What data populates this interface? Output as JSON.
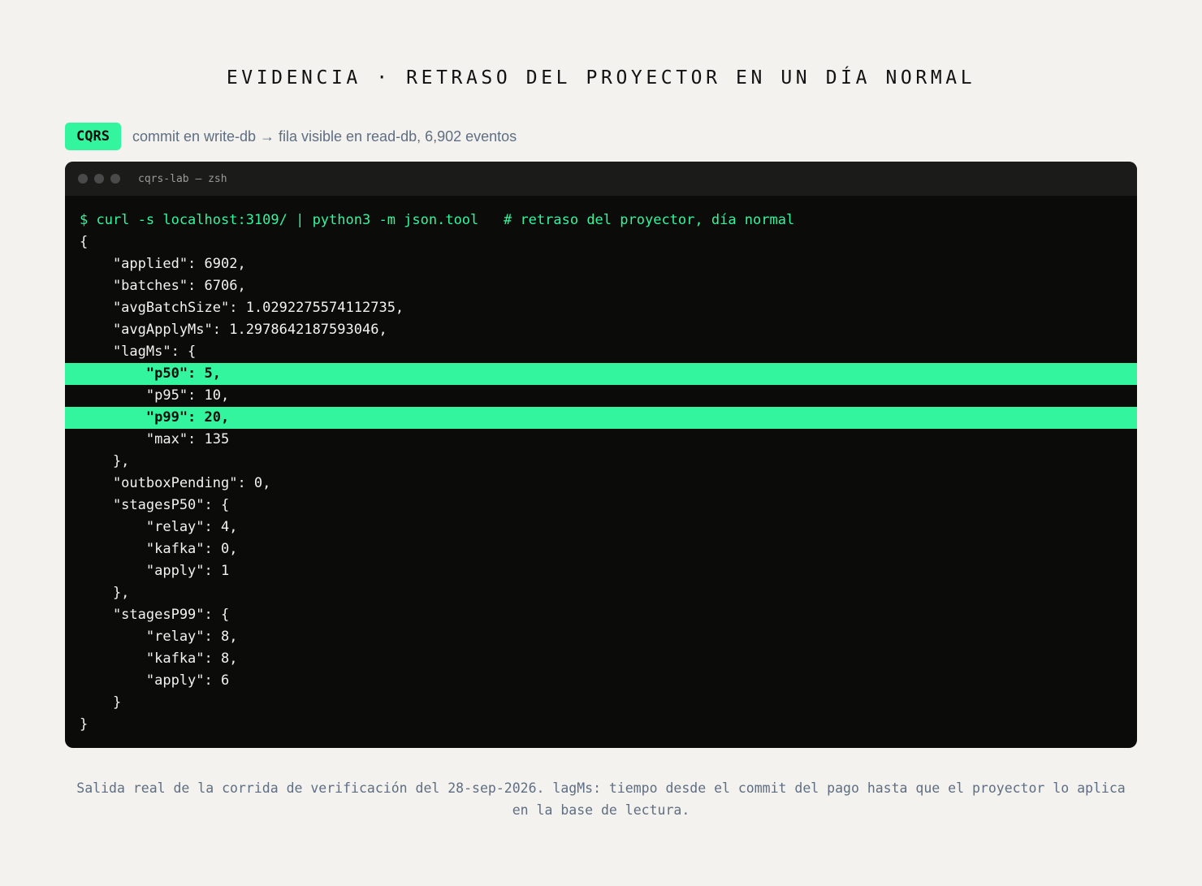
{
  "title": "EVIDENCIA · RETRASO DEL PROYECTOR EN UN DÍA NORMAL",
  "tag": {
    "label": "CQRS",
    "caption": "commit en write-db → fila visible en read-db, 6,902 eventos"
  },
  "terminal": {
    "window_title": "cqrs-lab — zsh",
    "lines": [
      {
        "text": "$ curl -s localhost:3109/ | python3 -m json.tool   # retraso del proyector, día normal",
        "kind": "cmd"
      },
      {
        "text": "{",
        "kind": "out"
      },
      {
        "text": "    \"applied\": 6902,",
        "kind": "out"
      },
      {
        "text": "    \"batches\": 6706,",
        "kind": "out"
      },
      {
        "text": "    \"avgBatchSize\": 1.0292275574112735,",
        "kind": "out"
      },
      {
        "text": "    \"avgApplyMs\": 1.2978642187593046,",
        "kind": "out"
      },
      {
        "text": "    \"lagMs\": {",
        "kind": "out"
      },
      {
        "text": "        \"p50\": 5,",
        "kind": "hl"
      },
      {
        "text": "        \"p95\": 10,",
        "kind": "out"
      },
      {
        "text": "        \"p99\": 20,",
        "kind": "hl"
      },
      {
        "text": "        \"max\": 135",
        "kind": "out"
      },
      {
        "text": "    },",
        "kind": "out"
      },
      {
        "text": "    \"outboxPending\": 0,",
        "kind": "out"
      },
      {
        "text": "    \"stagesP50\": {",
        "kind": "out"
      },
      {
        "text": "        \"relay\": 4,",
        "kind": "out"
      },
      {
        "text": "        \"kafka\": 0,",
        "kind": "out"
      },
      {
        "text": "        \"apply\": 1",
        "kind": "out"
      },
      {
        "text": "    },",
        "kind": "out"
      },
      {
        "text": "    \"stagesP99\": {",
        "kind": "out"
      },
      {
        "text": "        \"relay\": 8,",
        "kind": "out"
      },
      {
        "text": "        \"kafka\": 8,",
        "kind": "out"
      },
      {
        "text": "        \"apply\": 6",
        "kind": "out"
      },
      {
        "text": "    }",
        "kind": "out"
      },
      {
        "text": "}",
        "kind": "out"
      }
    ]
  },
  "footnote": "Salida real de la corrida de verificación del 28-sep-2026. lagMs: tiempo desde el commit del pago hasta que el proyector lo aplica en la base de lectura.",
  "colors": {
    "accent": "#33f59d",
    "terminal_bg": "#0b0b09",
    "page_bg": "#f3f2ee",
    "muted_text": "#5f6e82"
  }
}
